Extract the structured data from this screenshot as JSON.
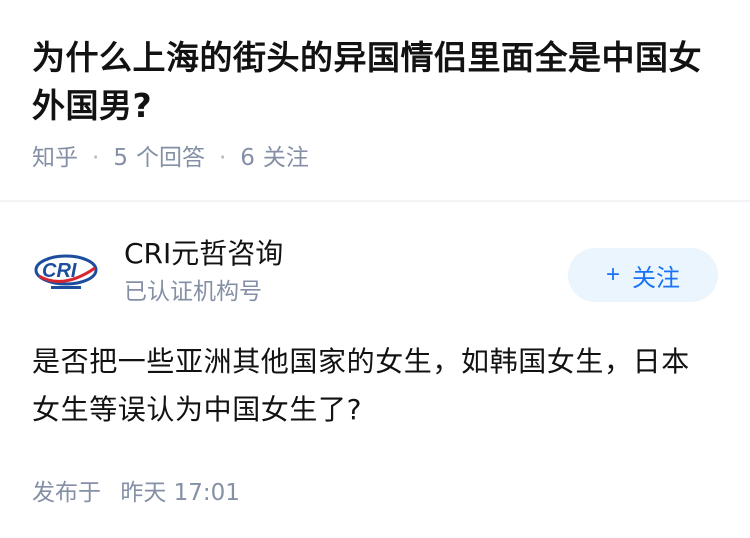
{
  "question": {
    "title": "为什么上海的街头的异国情侣里面全是中国女外国男?",
    "source": "知乎",
    "answers_count": "5",
    "answers_label": "个回答",
    "follows_count": "6",
    "follows_label": "关注"
  },
  "answer": {
    "author_name": "CRI元哲咨询",
    "author_badge": "已认证机构号",
    "avatar_text": "CRI",
    "follow_plus": "+",
    "follow_label": "关注",
    "content": "是否把一些亚洲其他国家的女生，如韩国女生，日本女生等误认为中国女生了?",
    "publish_label": "发布于",
    "publish_time": "昨天 17:01"
  },
  "colors": {
    "brand_blue": "#1772f6",
    "meta_gray": "#8590a6",
    "follow_bg": "#ebf5fd",
    "logo_blue": "#1d4e9e",
    "logo_red": "#d7262e"
  }
}
